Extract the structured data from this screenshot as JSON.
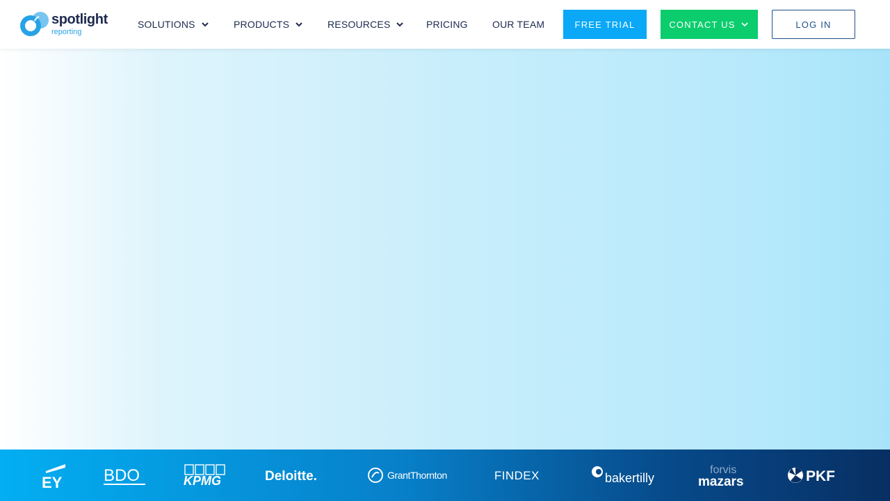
{
  "brand": {
    "name": "spotlight",
    "sub": "reporting",
    "colors": {
      "navy": "#1d2a4f",
      "blue": "#27a2e6",
      "light_blue": "#78c5f0"
    }
  },
  "nav": {
    "items": [
      {
        "label": "SOLUTIONS",
        "has_dropdown": true
      },
      {
        "label": "PRODUCTS",
        "has_dropdown": true
      },
      {
        "label": "RESOURCES",
        "has_dropdown": true
      },
      {
        "label": "PRICING",
        "has_dropdown": false
      },
      {
        "label": "OUR TEAM",
        "has_dropdown": false
      }
    ],
    "icon": "chevron-down-icon"
  },
  "buttons": {
    "free_trial": {
      "label": "FREE TRIAL",
      "color": "#0aa8f7"
    },
    "contact_us": {
      "label": "CONTACT US",
      "color": "#0ccd6e",
      "icon": "chevron-down-icon"
    },
    "log_in": {
      "label": "LOG IN",
      "color": "#1e4f8a"
    }
  },
  "client_logos": [
    {
      "name": "EY"
    },
    {
      "name": "BDO"
    },
    {
      "name": "KPMG"
    },
    {
      "name": "Deloitte."
    },
    {
      "name": "GrantThornton"
    },
    {
      "name": "FINDEX"
    },
    {
      "name": "bakertilly"
    },
    {
      "name": "forvis",
      "name2": "mazars"
    },
    {
      "name": "PKF"
    }
  ]
}
